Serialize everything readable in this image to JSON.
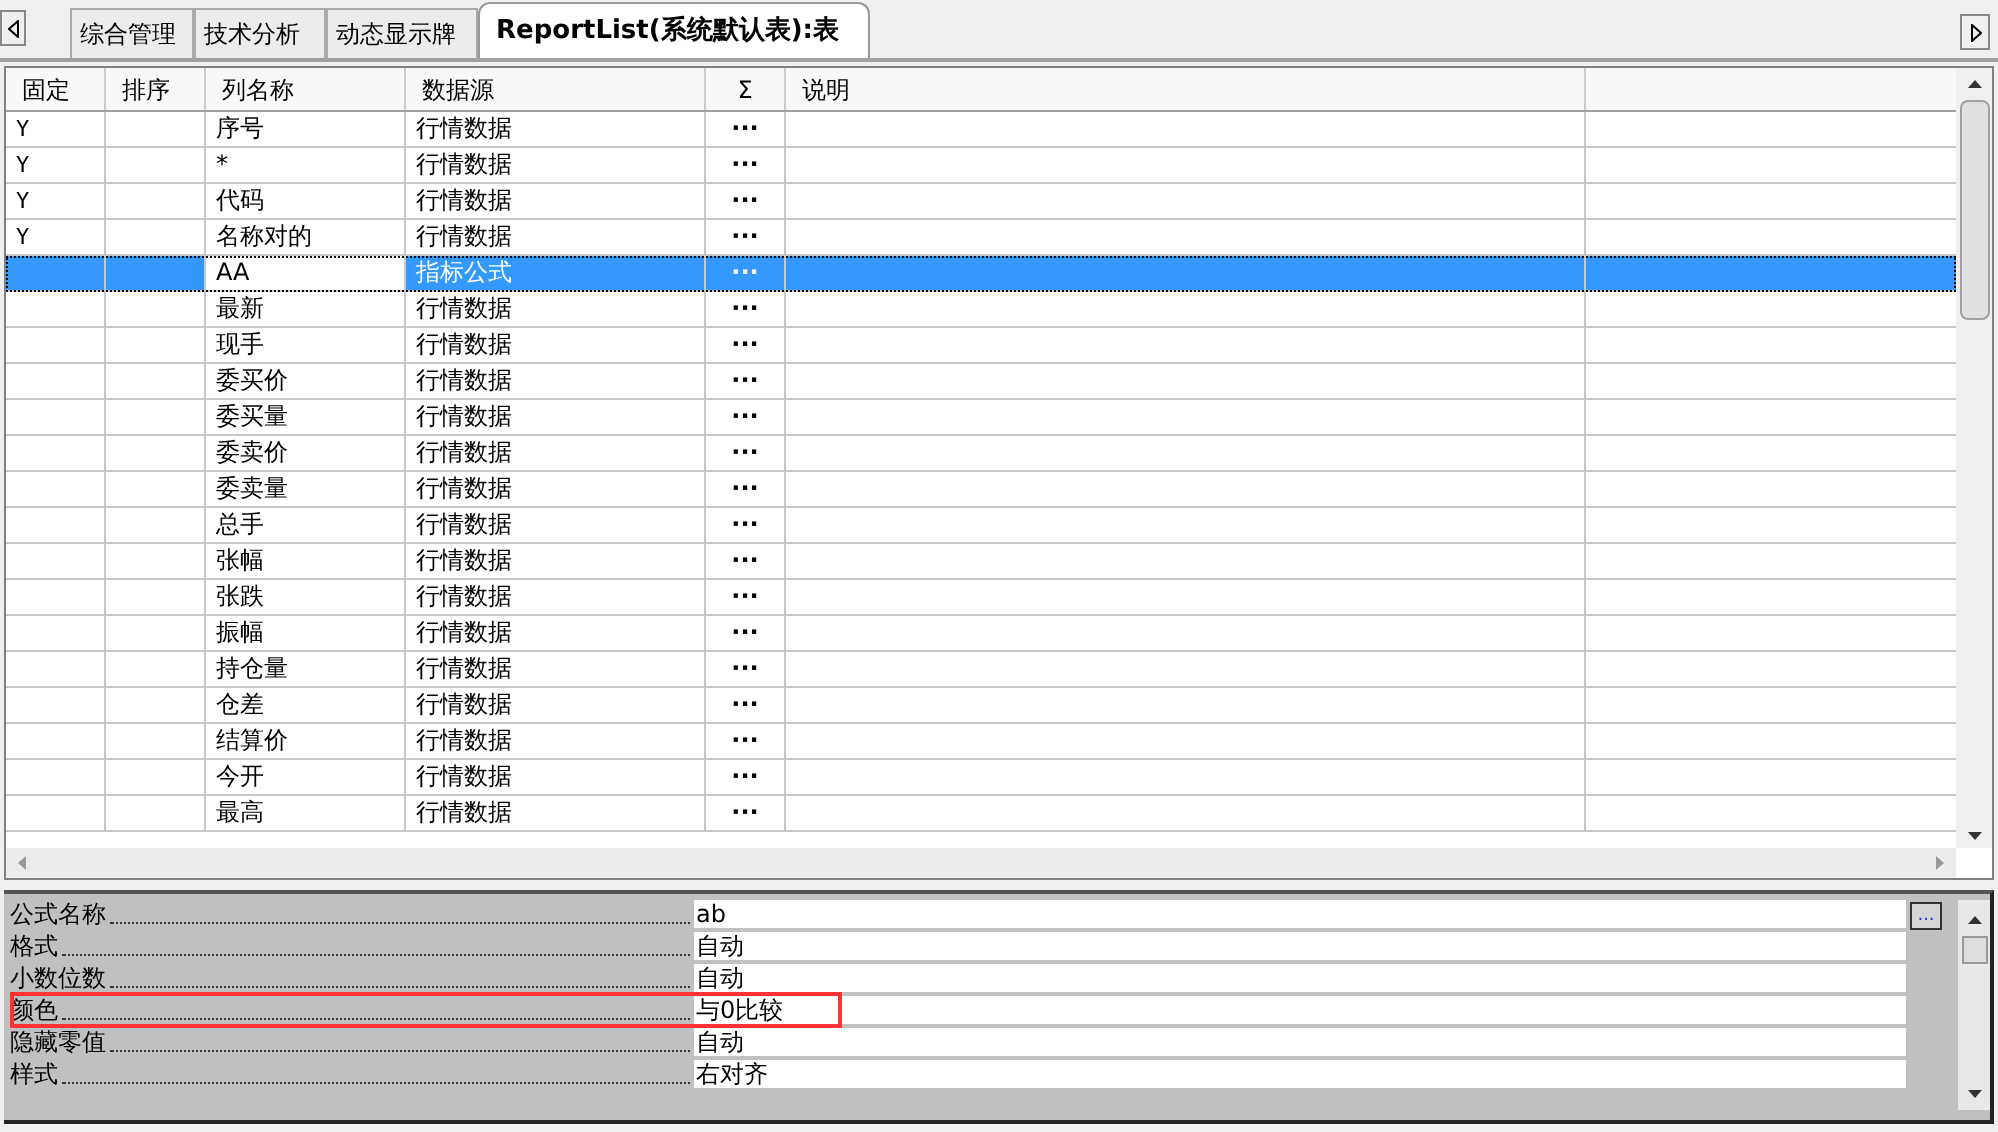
{
  "tabs": [
    {
      "label": "综合管理",
      "selected": false
    },
    {
      "label": "技术分析",
      "selected": false
    },
    {
      "label": "动态显示牌",
      "selected": false
    },
    {
      "label": "ReportList(系统默认表):表",
      "selected": true
    }
  ],
  "table": {
    "columns": [
      "固定",
      "排序",
      "列名称",
      "数据源",
      "Σ",
      "说明"
    ],
    "rows": [
      {
        "fixed": "Y",
        "name": "序号",
        "source": "行情数据",
        "sum": "···",
        "selected": false
      },
      {
        "fixed": "Y",
        "name": "*",
        "source": "行情数据",
        "sum": "···",
        "selected": false
      },
      {
        "fixed": "Y",
        "name": "代码",
        "source": "行情数据",
        "sum": "···",
        "selected": false
      },
      {
        "fixed": "Y",
        "name": "名称对的",
        "source": "行情数据",
        "sum": "···",
        "selected": false
      },
      {
        "name": "AA",
        "source": "指标公式",
        "sum": "···",
        "selected": true
      },
      {
        "name": "最新",
        "source": "行情数据",
        "sum": "···",
        "selected": false
      },
      {
        "name": "现手",
        "source": "行情数据",
        "sum": "···",
        "selected": false
      },
      {
        "name": "委买价",
        "source": "行情数据",
        "sum": "···",
        "selected": false
      },
      {
        "name": "委买量",
        "source": "行情数据",
        "sum": "···",
        "selected": false
      },
      {
        "name": "委卖价",
        "source": "行情数据",
        "sum": "···",
        "selected": false
      },
      {
        "name": "委卖量",
        "source": "行情数据",
        "sum": "···",
        "selected": false
      },
      {
        "name": "总手",
        "source": "行情数据",
        "sum": "···",
        "selected": false
      },
      {
        "name": "张幅",
        "source": "行情数据",
        "sum": "···",
        "selected": false
      },
      {
        "name": "张跌",
        "source": "行情数据",
        "sum": "···",
        "selected": false
      },
      {
        "name": "振幅",
        "source": "行情数据",
        "sum": "···",
        "selected": false
      },
      {
        "name": "持仓量",
        "source": "行情数据",
        "sum": "···",
        "selected": false
      },
      {
        "name": "仓差",
        "source": "行情数据",
        "sum": "···",
        "selected": false
      },
      {
        "name": "结算价",
        "source": "行情数据",
        "sum": "···",
        "selected": false
      },
      {
        "name": "今开",
        "source": "行情数据",
        "sum": "···",
        "selected": false
      },
      {
        "name": "最高",
        "source": "行情数据",
        "sum": "···",
        "selected": false
      }
    ]
  },
  "properties": [
    {
      "label": "公式名称",
      "value": "ab",
      "highlighted": false,
      "button": "..."
    },
    {
      "label": "格式",
      "value": "自动",
      "highlighted": false
    },
    {
      "label": "小数位数",
      "value": "自动",
      "highlighted": false
    },
    {
      "label": "颜色",
      "value": "与0比较",
      "highlighted": true
    },
    {
      "label": "隐藏零值",
      "value": "自动",
      "highlighted": false
    },
    {
      "label": "样式",
      "value": "右对齐",
      "highlighted": false
    }
  ]
}
